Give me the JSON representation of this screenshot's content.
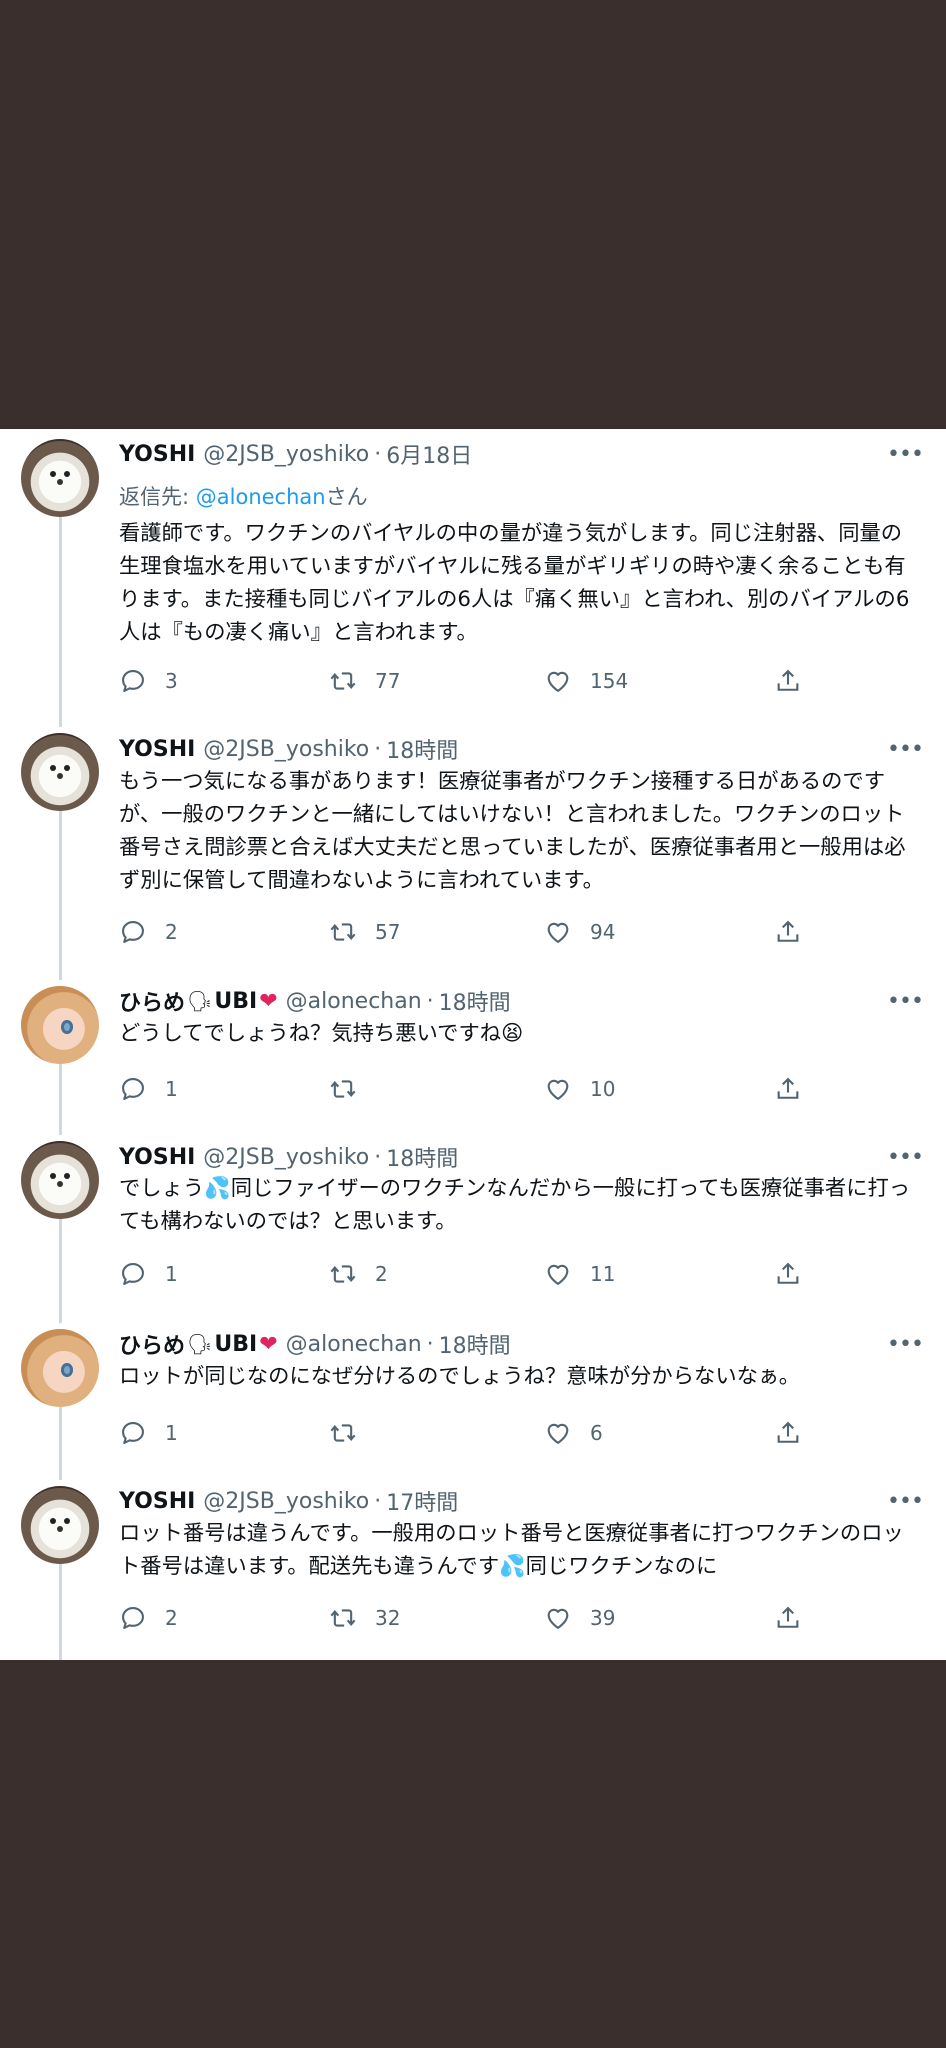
{
  "tweets": [
    {
      "name": "YOSHI",
      "handle": "@2JSB_yoshiko",
      "time": "6月18日",
      "reply_to_prefix": "返信先: ",
      "reply_to_mention": "@alonechan",
      "reply_to_suffix": "さん",
      "text": "看護師です。ワクチンのバイヤルの中の量が違う気がします。同じ注射器、同量の生理食塩水を用いていますがバイヤルに残る量がギリギリの時や凄く余ることも有ります。また接種も同じバイアルの6人は『痛く無い』と言われ、別のバイアルの6人は『もの凄く痛い』と言われます。",
      "replies": "3",
      "retweets": "77",
      "likes": "154"
    },
    {
      "name": "YOSHI",
      "handle": "@2JSB_yoshiko",
      "time": "18時間",
      "text": "もう一つ気になる事があります！医療従事者がワクチン接種する日があるのですが、一般のワクチンと一緒にしてはいけない！と言われました。ワクチンのロット番号さえ問診票と合えば大丈夫だと思っていましたが、医療従事者用と一般用は必ず別に保管して間違わないように言われています。",
      "replies": "2",
      "retweets": "57",
      "likes": "94"
    },
    {
      "name": "ひらめ",
      "name_emoji": "🗣",
      "name_suffix": "UBI",
      "name_heart": "❤",
      "handle": "@alonechan",
      "time": "18時間",
      "text": "どうしてでしょうね？気持ち悪いですね😫",
      "replies": "1",
      "retweets": "",
      "likes": "10"
    },
    {
      "name": "YOSHI",
      "handle": "@2JSB_yoshiko",
      "time": "18時間",
      "text": "でしょう💦同じファイザーのワクチンなんだから一般に打っても医療従事者に打っても構わないのでは？と思います。",
      "replies": "1",
      "retweets": "2",
      "likes": "11"
    },
    {
      "name": "ひらめ",
      "name_emoji": "🗣",
      "name_suffix": "UBI",
      "name_heart": "❤",
      "handle": "@alonechan",
      "time": "18時間",
      "text": "ロットが同じなのになぜ分けるのでしょうね？意味が分からないなぁ。",
      "replies": "1",
      "retweets": "",
      "likes": "6"
    },
    {
      "name": "YOSHI",
      "handle": "@2JSB_yoshiko",
      "time": "17時間",
      "text": "ロット番号は違うんです。一般用のロット番号と医療従事者に打つワクチンのロット番号は違います。配送先も違うんです💦同じワクチンなのに",
      "replies": "2",
      "retweets": "32",
      "likes": "39"
    }
  ],
  "ui": {
    "more_glyph": "•••",
    "dot": "·"
  },
  "colors": {
    "background": "#3b2f2e",
    "mention": "#1d9bf0",
    "secondary": "#536471",
    "heart": "#e0245e"
  }
}
